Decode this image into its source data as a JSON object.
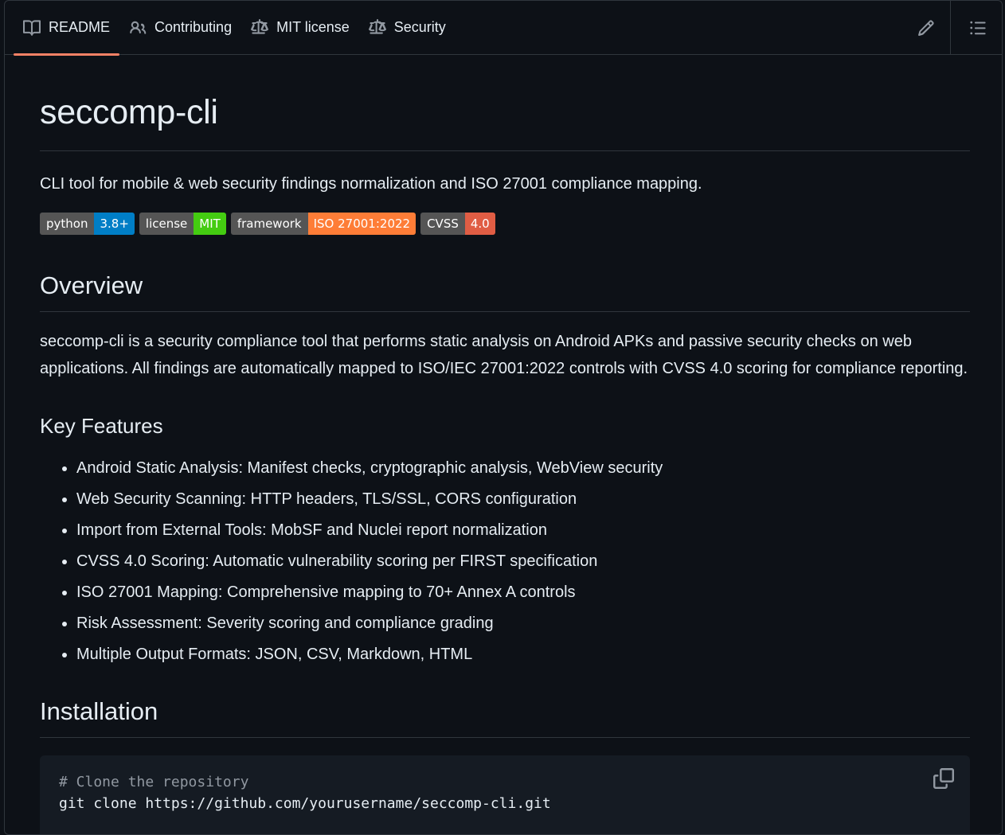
{
  "tabs": [
    {
      "label": "README",
      "icon": "book-icon",
      "active": true
    },
    {
      "label": "Contributing",
      "icon": "people-icon"
    },
    {
      "label": "MIT license",
      "icon": "law-icon"
    },
    {
      "label": "Security",
      "icon": "law-icon"
    }
  ],
  "title": "seccomp-cli",
  "description": "CLI tool for mobile & web security findings normalization and ISO 27001 compliance mapping.",
  "badges": [
    {
      "label": "python",
      "value": "3.8+",
      "color": "#007ec6"
    },
    {
      "label": "license",
      "value": "MIT",
      "color": "#4c1"
    },
    {
      "label": "framework",
      "value": "ISO 27001:2022",
      "color": "#fe7d37"
    },
    {
      "label": "CVSS",
      "value": "4.0",
      "color": "#e05d44"
    }
  ],
  "overview": {
    "heading": "Overview",
    "text": "seccomp-cli is a security compliance tool that performs static analysis on Android APKs and passive security checks on web applications. All findings are automatically mapped to ISO/IEC 27001:2022 controls with CVSS 4.0 scoring for compliance reporting."
  },
  "features": {
    "heading": "Key Features",
    "items": [
      "Android Static Analysis: Manifest checks, cryptographic analysis, WebView security",
      "Web Security Scanning: HTTP headers, TLS/SSL, CORS configuration",
      "Import from External Tools: MobSF and Nuclei report normalization",
      "CVSS 4.0 Scoring: Automatic vulnerability scoring per FIRST specification",
      "ISO 27001 Mapping: Comprehensive mapping to 70+ Annex A controls",
      "Risk Assessment: Severity scoring and compliance grading",
      "Multiple Output Formats: JSON, CSV, Markdown, HTML"
    ]
  },
  "installation": {
    "heading": "Installation",
    "code_comment": "# Clone the repository",
    "code_line": "git clone https://github.com/yourusername/seccomp-cli.git"
  }
}
